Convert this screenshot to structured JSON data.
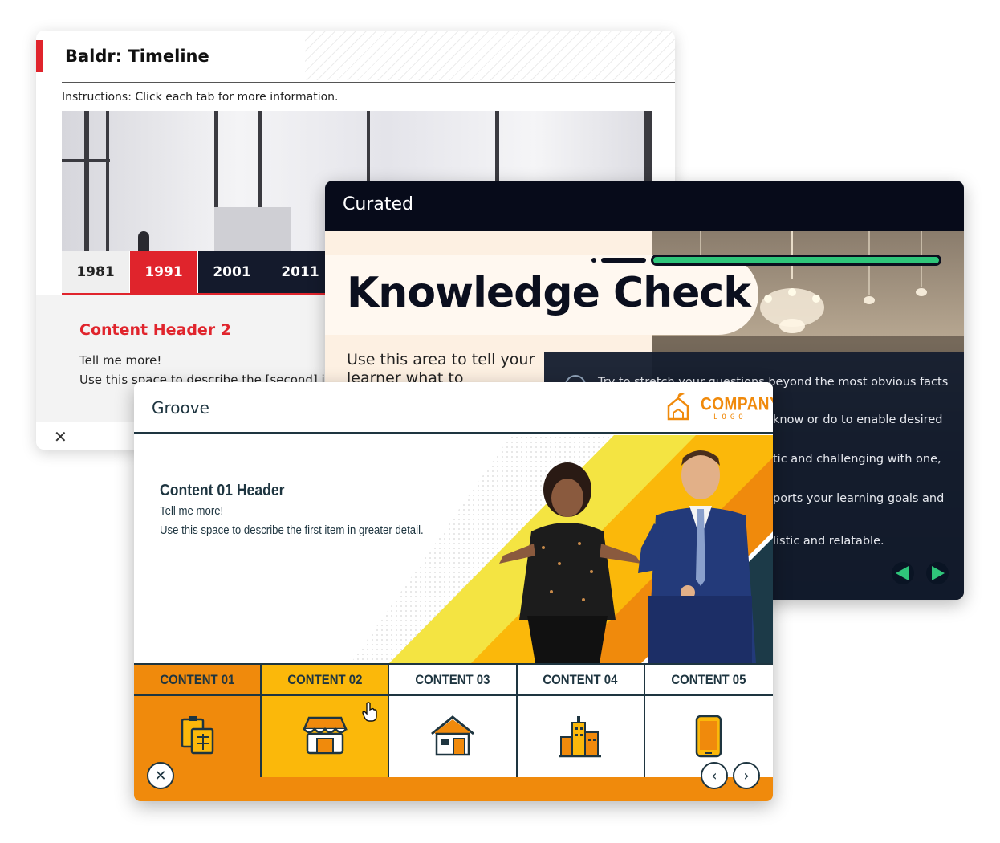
{
  "baldr": {
    "title": "Baldr: Timeline",
    "instructions": "Instructions: Click each tab for more information.",
    "tabs": [
      "1981",
      "1991",
      "2001",
      "2011"
    ],
    "active_tab": "1991",
    "content_header": "Content Header 2",
    "content_line1": "Tell me more!",
    "content_line2": "Use this space to describe the [second] ite",
    "close_icon": "close-icon",
    "accent_color": "#e0242c"
  },
  "curated": {
    "title": "Curated",
    "heading": "Knowledge Check",
    "body": "Use this area to tell your learner what to",
    "overlay_lines": [
      "Try to stretch your questions beyond the most obvious facts",
      "know or do to enable desired",
      "tic and challenging with one,",
      "ports your learning goals and",
      "listic and relatable."
    ],
    "nav_prev_icon": "triangle-left-icon",
    "nav_next_icon": "triangle-right-icon",
    "accent_color": "#2fc57a"
  },
  "groove": {
    "title": "Groove",
    "logo_text": "COMPANY",
    "logo_sub": "LOGO",
    "content_header": "Content 01 Header",
    "content_line1": "Tell me more!",
    "content_line2": "Use this space to describe the first item in greater detail.",
    "tabs": [
      {
        "label": "CONTENT 01",
        "icon": "blueprint-icon"
      },
      {
        "label": "CONTENT 02",
        "icon": "storefront-icon"
      },
      {
        "label": "CONTENT 03",
        "icon": "house-icon"
      },
      {
        "label": "CONTENT 04",
        "icon": "city-buildings-icon"
      },
      {
        "label": "CONTENT 05",
        "icon": "smartphone-icon"
      }
    ],
    "close_icon": "close-icon",
    "prev_icon": "chevron-left-icon",
    "next_icon": "chevron-right-icon",
    "accent_color": "#f08a0c",
    "secondary_color": "#fbb80a"
  }
}
